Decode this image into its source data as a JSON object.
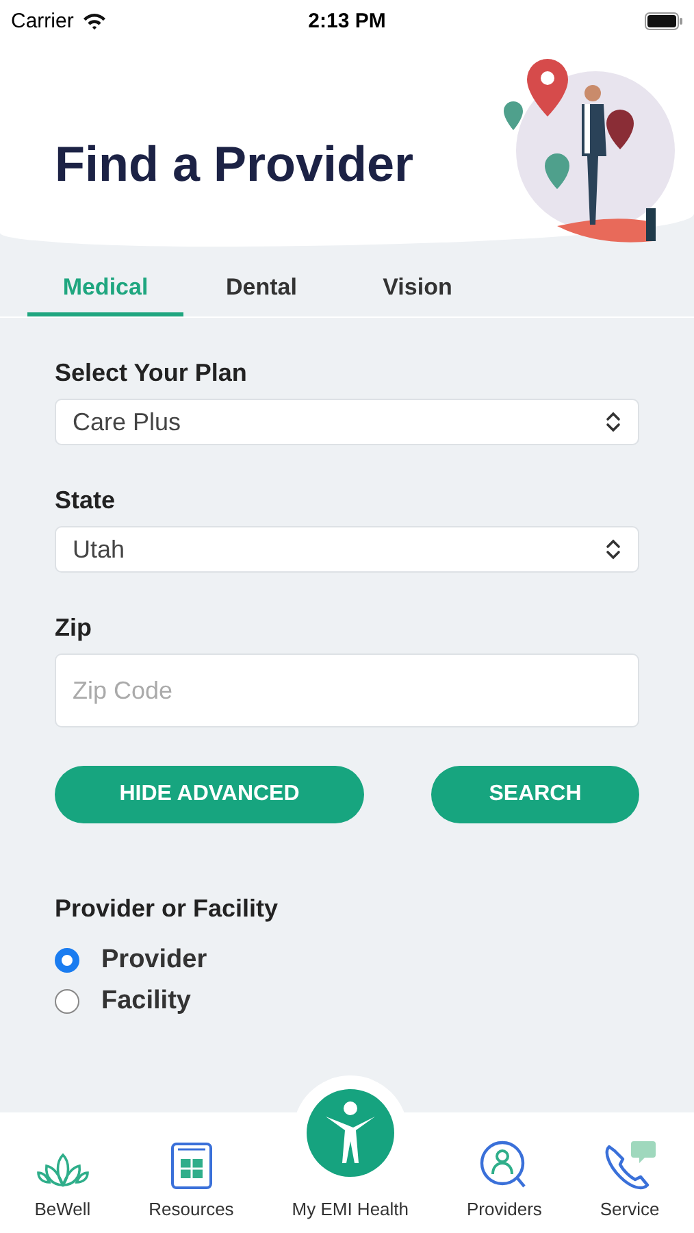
{
  "status_bar": {
    "carrier": "Carrier",
    "time": "2:13 PM"
  },
  "header": {
    "title": "Find a Provider"
  },
  "tabs": [
    {
      "label": "Medical",
      "selected": true
    },
    {
      "label": "Dental",
      "selected": false
    },
    {
      "label": "Vision",
      "selected": false
    }
  ],
  "form": {
    "fields": [
      {
        "kind": "select",
        "label": "Select Your Plan",
        "value": "Care Plus"
      },
      {
        "kind": "select",
        "label": "State",
        "value": "Utah"
      },
      {
        "kind": "text",
        "label": "Zip",
        "placeholder": "Zip Code"
      }
    ],
    "buttons": [
      "HIDE ADVANCED",
      "SEARCH"
    ],
    "provider_or_facility": {
      "label": "Provider or Facility",
      "options": [
        {
          "label": "Provider",
          "selected": true
        },
        {
          "label": "Facility",
          "selected": false
        }
      ]
    }
  },
  "tab_bar": [
    {
      "label": "BeWell",
      "kind": "lotus"
    },
    {
      "label": "Resources",
      "kind": "calculator"
    },
    {
      "label": "My EMI Health",
      "kind": "center"
    },
    {
      "label": "Providers",
      "kind": "person"
    },
    {
      "label": "Service",
      "kind": "phone"
    }
  ]
}
